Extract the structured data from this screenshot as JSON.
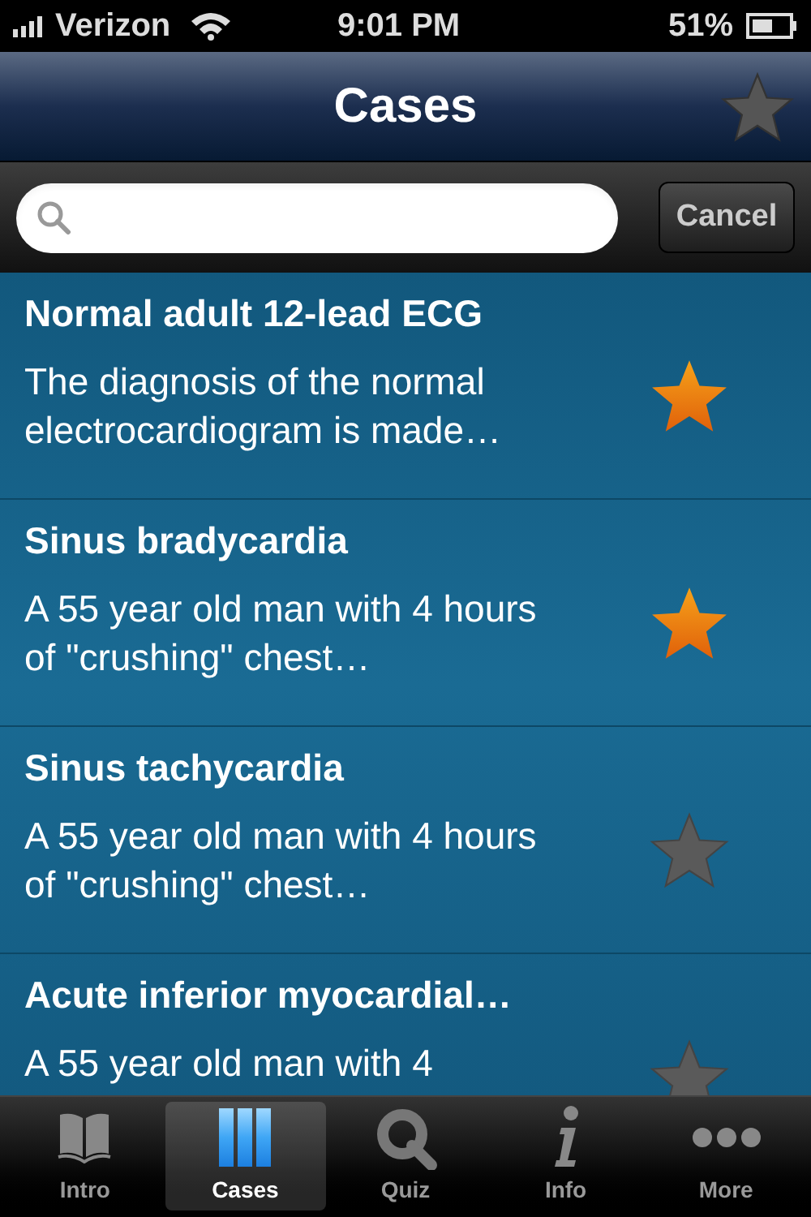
{
  "status_bar": {
    "carrier": "Verizon",
    "time": "9:01 PM",
    "battery": "51%"
  },
  "nav": {
    "title": "Cases"
  },
  "search": {
    "cancel": "Cancel"
  },
  "cases": [
    {
      "title": "Normal adult 12-lead ECG",
      "description": "The diagnosis of the normal electrocardiogram is made…",
      "favorite": true
    },
    {
      "title": "Sinus bradycardia",
      "description": "A 55 year old man with 4 hours of \"crushing\" chest…",
      "favorite": true
    },
    {
      "title": "Sinus tachycardia",
      "description": "A 55 year old man with 4 hours of \"crushing\" chest…",
      "favorite": false
    },
    {
      "title": "Acute inferior myocardial…",
      "description": "A 55 year old man with 4",
      "favorite": false
    }
  ],
  "tabs": [
    {
      "kind": "book",
      "label": "Intro",
      "selected": false
    },
    {
      "kind": "columns",
      "label": "Cases",
      "selected": true
    },
    {
      "kind": "quiz",
      "label": "Quiz",
      "selected": false
    },
    {
      "kind": "info",
      "label": "Info",
      "selected": false
    },
    {
      "kind": "more",
      "label": "More",
      "selected": false
    }
  ]
}
